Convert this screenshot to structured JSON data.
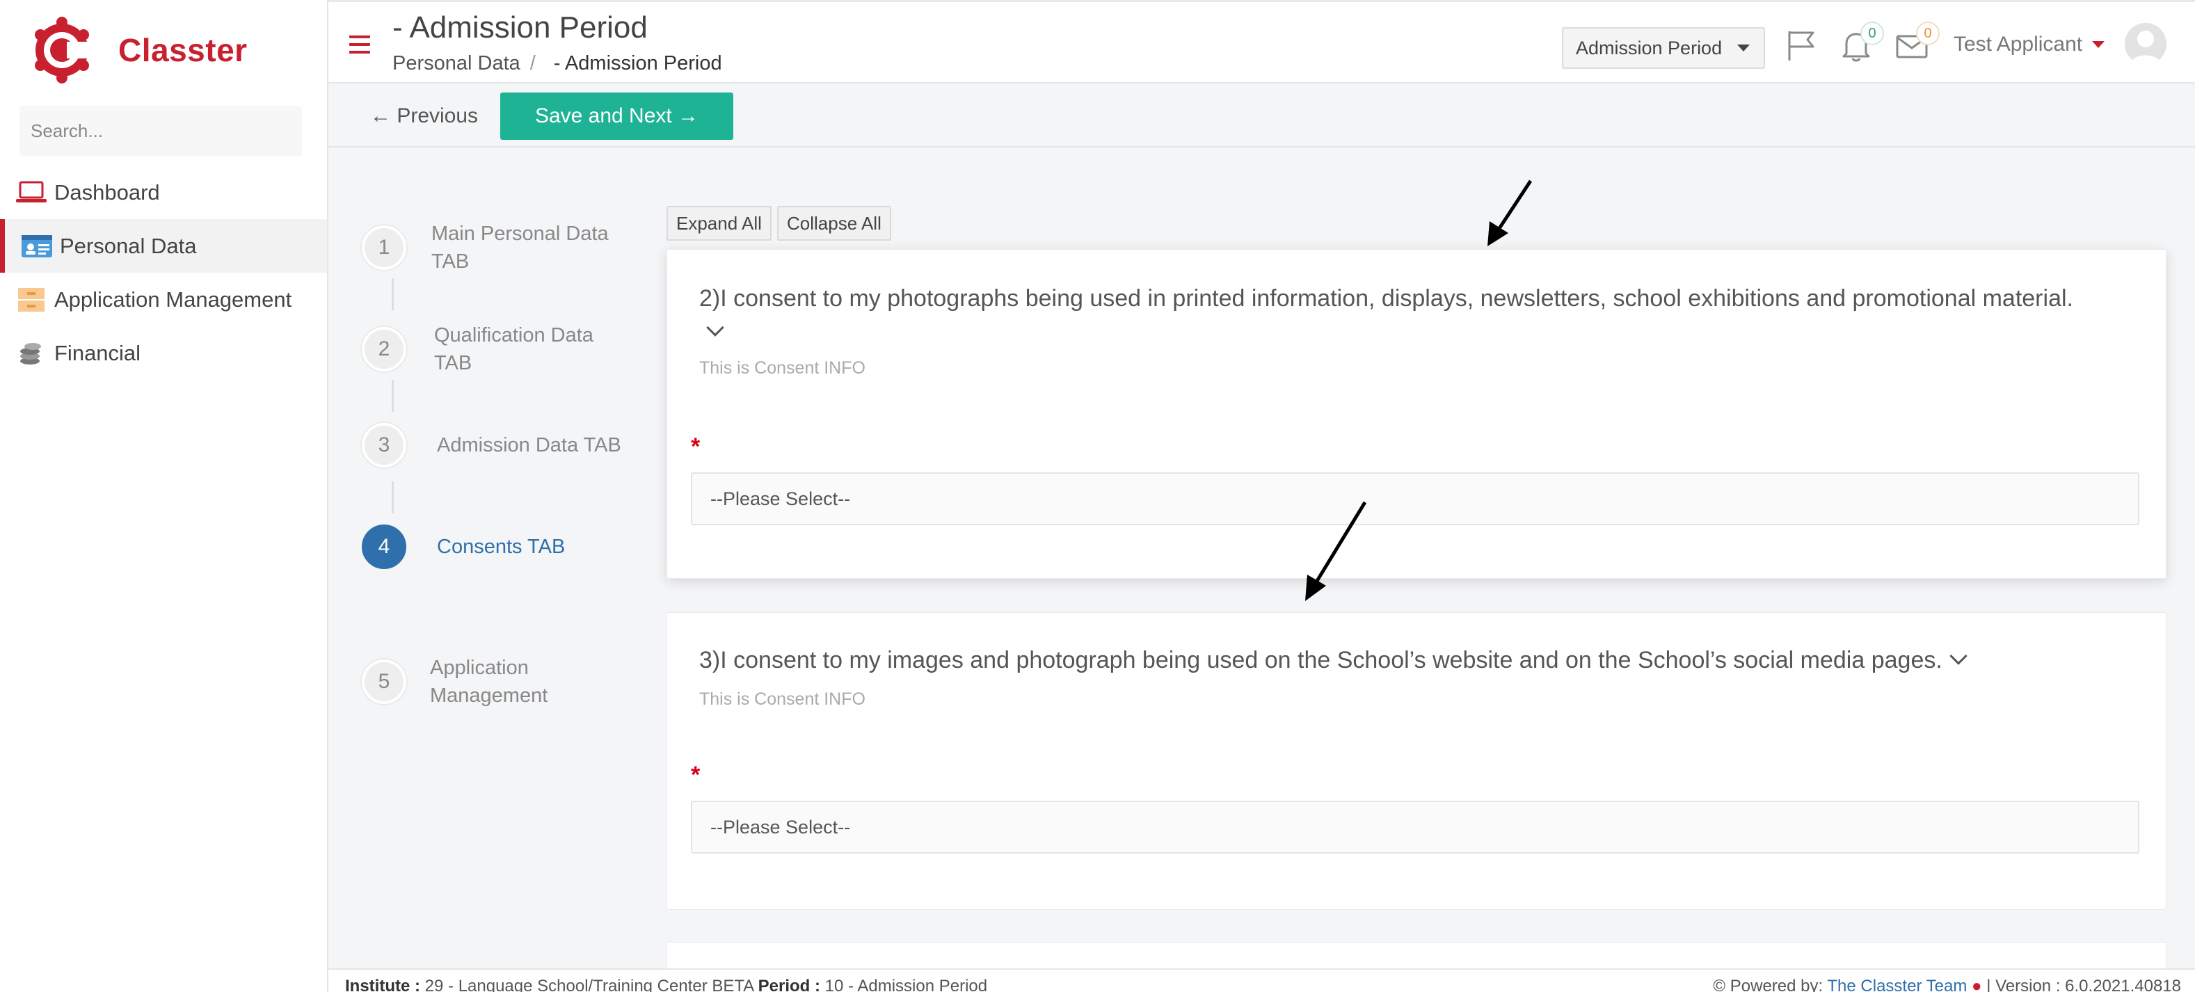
{
  "app": {
    "brand": "Classter"
  },
  "sidebar": {
    "search_placeholder": "Search...",
    "items": [
      {
        "label": "Dashboard",
        "icon": "laptop-icon"
      },
      {
        "label": "Personal Data",
        "icon": "id-card-icon",
        "active": true
      },
      {
        "label": "Application Management",
        "icon": "cabinet-icon"
      },
      {
        "label": "Financial",
        "icon": "coins-icon"
      }
    ]
  },
  "header": {
    "title": "- Admission Period",
    "breadcrumb": [
      "Personal Data",
      "/",
      "- Admission Period"
    ],
    "period_dropdown": "Admission Period",
    "notifications_count": "0",
    "messages_count": "0",
    "user_name": "Test Applicant"
  },
  "actions": {
    "previous": "← Previous",
    "save_next": "Save and Next →"
  },
  "steps": [
    {
      "number": "1",
      "label": "Main Personal Data TAB"
    },
    {
      "number": "2",
      "label": "Qualification Data TAB"
    },
    {
      "number": "3",
      "label": "Admission Data TAB"
    },
    {
      "number": "4",
      "label": "Consents TAB",
      "active": true
    },
    {
      "number": "5",
      "label": "Application Management"
    }
  ],
  "content": {
    "expand_all": "Expand All",
    "collapse_all": "Collapse All",
    "consents": [
      {
        "title": "2)I consent to my photographs being used in printed information, displays, newsletters, school exhibitions and promotional material.",
        "info": "This is Consent INFO",
        "required_mark": "*",
        "select_value": "--Please Select--"
      },
      {
        "title": "3)I consent to my images and photograph being used on the School’s website and on the School’s social media pages.",
        "info": "This is Consent INFO",
        "required_mark": "*",
        "select_value": "--Please Select--"
      }
    ]
  },
  "footer": {
    "institute_label": "Institute :",
    "institute_value": "29 - Language School/Training Center BETA",
    "period_label": "Period :",
    "period_value": "10 - Admission Period",
    "powered_by": "Powered by:",
    "team": "The Classter Team",
    "version": "| Version : 6.0.2021.40818"
  },
  "colors": {
    "brand_red": "#c8202e",
    "accent_green": "#1db394",
    "active_blue": "#2f6fab"
  }
}
